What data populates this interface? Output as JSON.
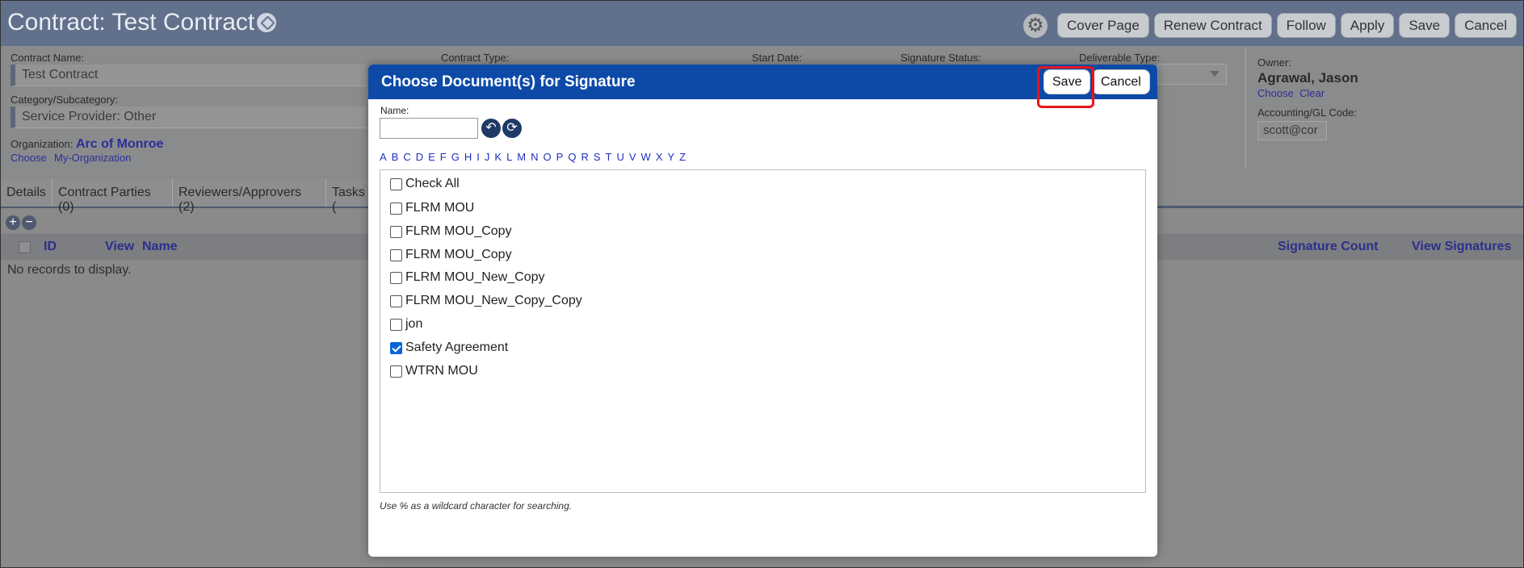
{
  "app": {
    "title": "Contract: Test Contract",
    "top_buttons": [
      "Cover Page",
      "Renew Contract",
      "Follow",
      "Apply",
      "Save",
      "Cancel"
    ]
  },
  "form": {
    "contract_name_label": "Contract Name:",
    "contract_name_value": "Test Contract",
    "contract_type_label": "Contract Type:",
    "start_date_label": "Start Date:",
    "signature_status_label": "Signature Status:",
    "deliverable_type_label": "Deliverable Type:",
    "category_label": "Category/Subcategory:",
    "category_value": "Service Provider: Other",
    "organization_label": "Organization:",
    "organization_value": "Arc of Monroe",
    "org_links": [
      "Choose",
      "My-Organization"
    ],
    "owner_label": "Owner:",
    "owner_value": "Agrawal, Jason",
    "owner_links": [
      "Choose",
      "Clear"
    ],
    "accounting_label": "Accounting/GL Code:",
    "accounting_value": "scott@cor"
  },
  "tabs": [
    "Details",
    "Contract Parties (0)",
    "Reviewers/Approvers (2)",
    "Tasks ("
  ],
  "grid": {
    "columns": [
      "ID",
      "View",
      "Name",
      "Signature Count",
      "View Signatures"
    ],
    "empty_text": "No records to display."
  },
  "modal": {
    "title": "Choose Document(s) for Signature",
    "save_label": "Save",
    "cancel_label": "Cancel",
    "name_label": "Name:",
    "name_value": "",
    "letters": [
      "A",
      "B",
      "C",
      "D",
      "E",
      "F",
      "G",
      "H",
      "I",
      "J",
      "K",
      "L",
      "M",
      "N",
      "O",
      "P",
      "Q",
      "R",
      "S",
      "T",
      "U",
      "V",
      "W",
      "X",
      "Y",
      "Z"
    ],
    "check_all_label": "Check All",
    "documents": [
      {
        "label": "FLRM MOU",
        "checked": false
      },
      {
        "label": "FLRM MOU_Copy",
        "checked": false
      },
      {
        "label": "FLRM MOU_Copy",
        "checked": false
      },
      {
        "label": "FLRM MOU_New_Copy",
        "checked": false
      },
      {
        "label": "FLRM MOU_New_Copy_Copy",
        "checked": false
      },
      {
        "label": "jon",
        "checked": false
      },
      {
        "label": "Safety Agreement",
        "checked": true
      },
      {
        "label": "WTRN MOU",
        "checked": false
      }
    ],
    "hint": "Use % as a wildcard character for searching."
  },
  "colors": {
    "modal_header": "#0d4aa8",
    "highlight": "#e8141c",
    "topbar": "#61708b"
  }
}
